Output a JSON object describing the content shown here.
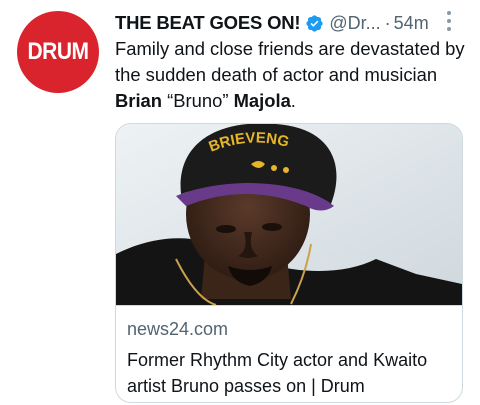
{
  "avatar": {
    "logo_text": "DRUM",
    "brand_color": "#d9232d"
  },
  "header": {
    "display_name": "THE BEAT GOES ON!",
    "verified_icon": "verified-badge-icon",
    "verified_color": "#1d9bf0",
    "handle": "@Dr...",
    "separator": "·",
    "timestamp": "54m",
    "more_icon": "more-vertical-icon"
  },
  "tweet": {
    "text_part1": "Family and close friends are devastated by the sudden death of actor and musician ",
    "text_bold1": "Brian",
    "text_part2": " “Bruno” ",
    "text_bold2": "Majola",
    "text_part3": "."
  },
  "card": {
    "domain": "news24.com",
    "title": "Former Rhythm City actor and Kwaito artist Bruno passes on | Drum",
    "image_cap_text": "BRIEVENG",
    "image_cap_color": "#1b1b1b",
    "image_brim_color": "#6a3a8a",
    "image_text_color": "#e7b52a"
  }
}
